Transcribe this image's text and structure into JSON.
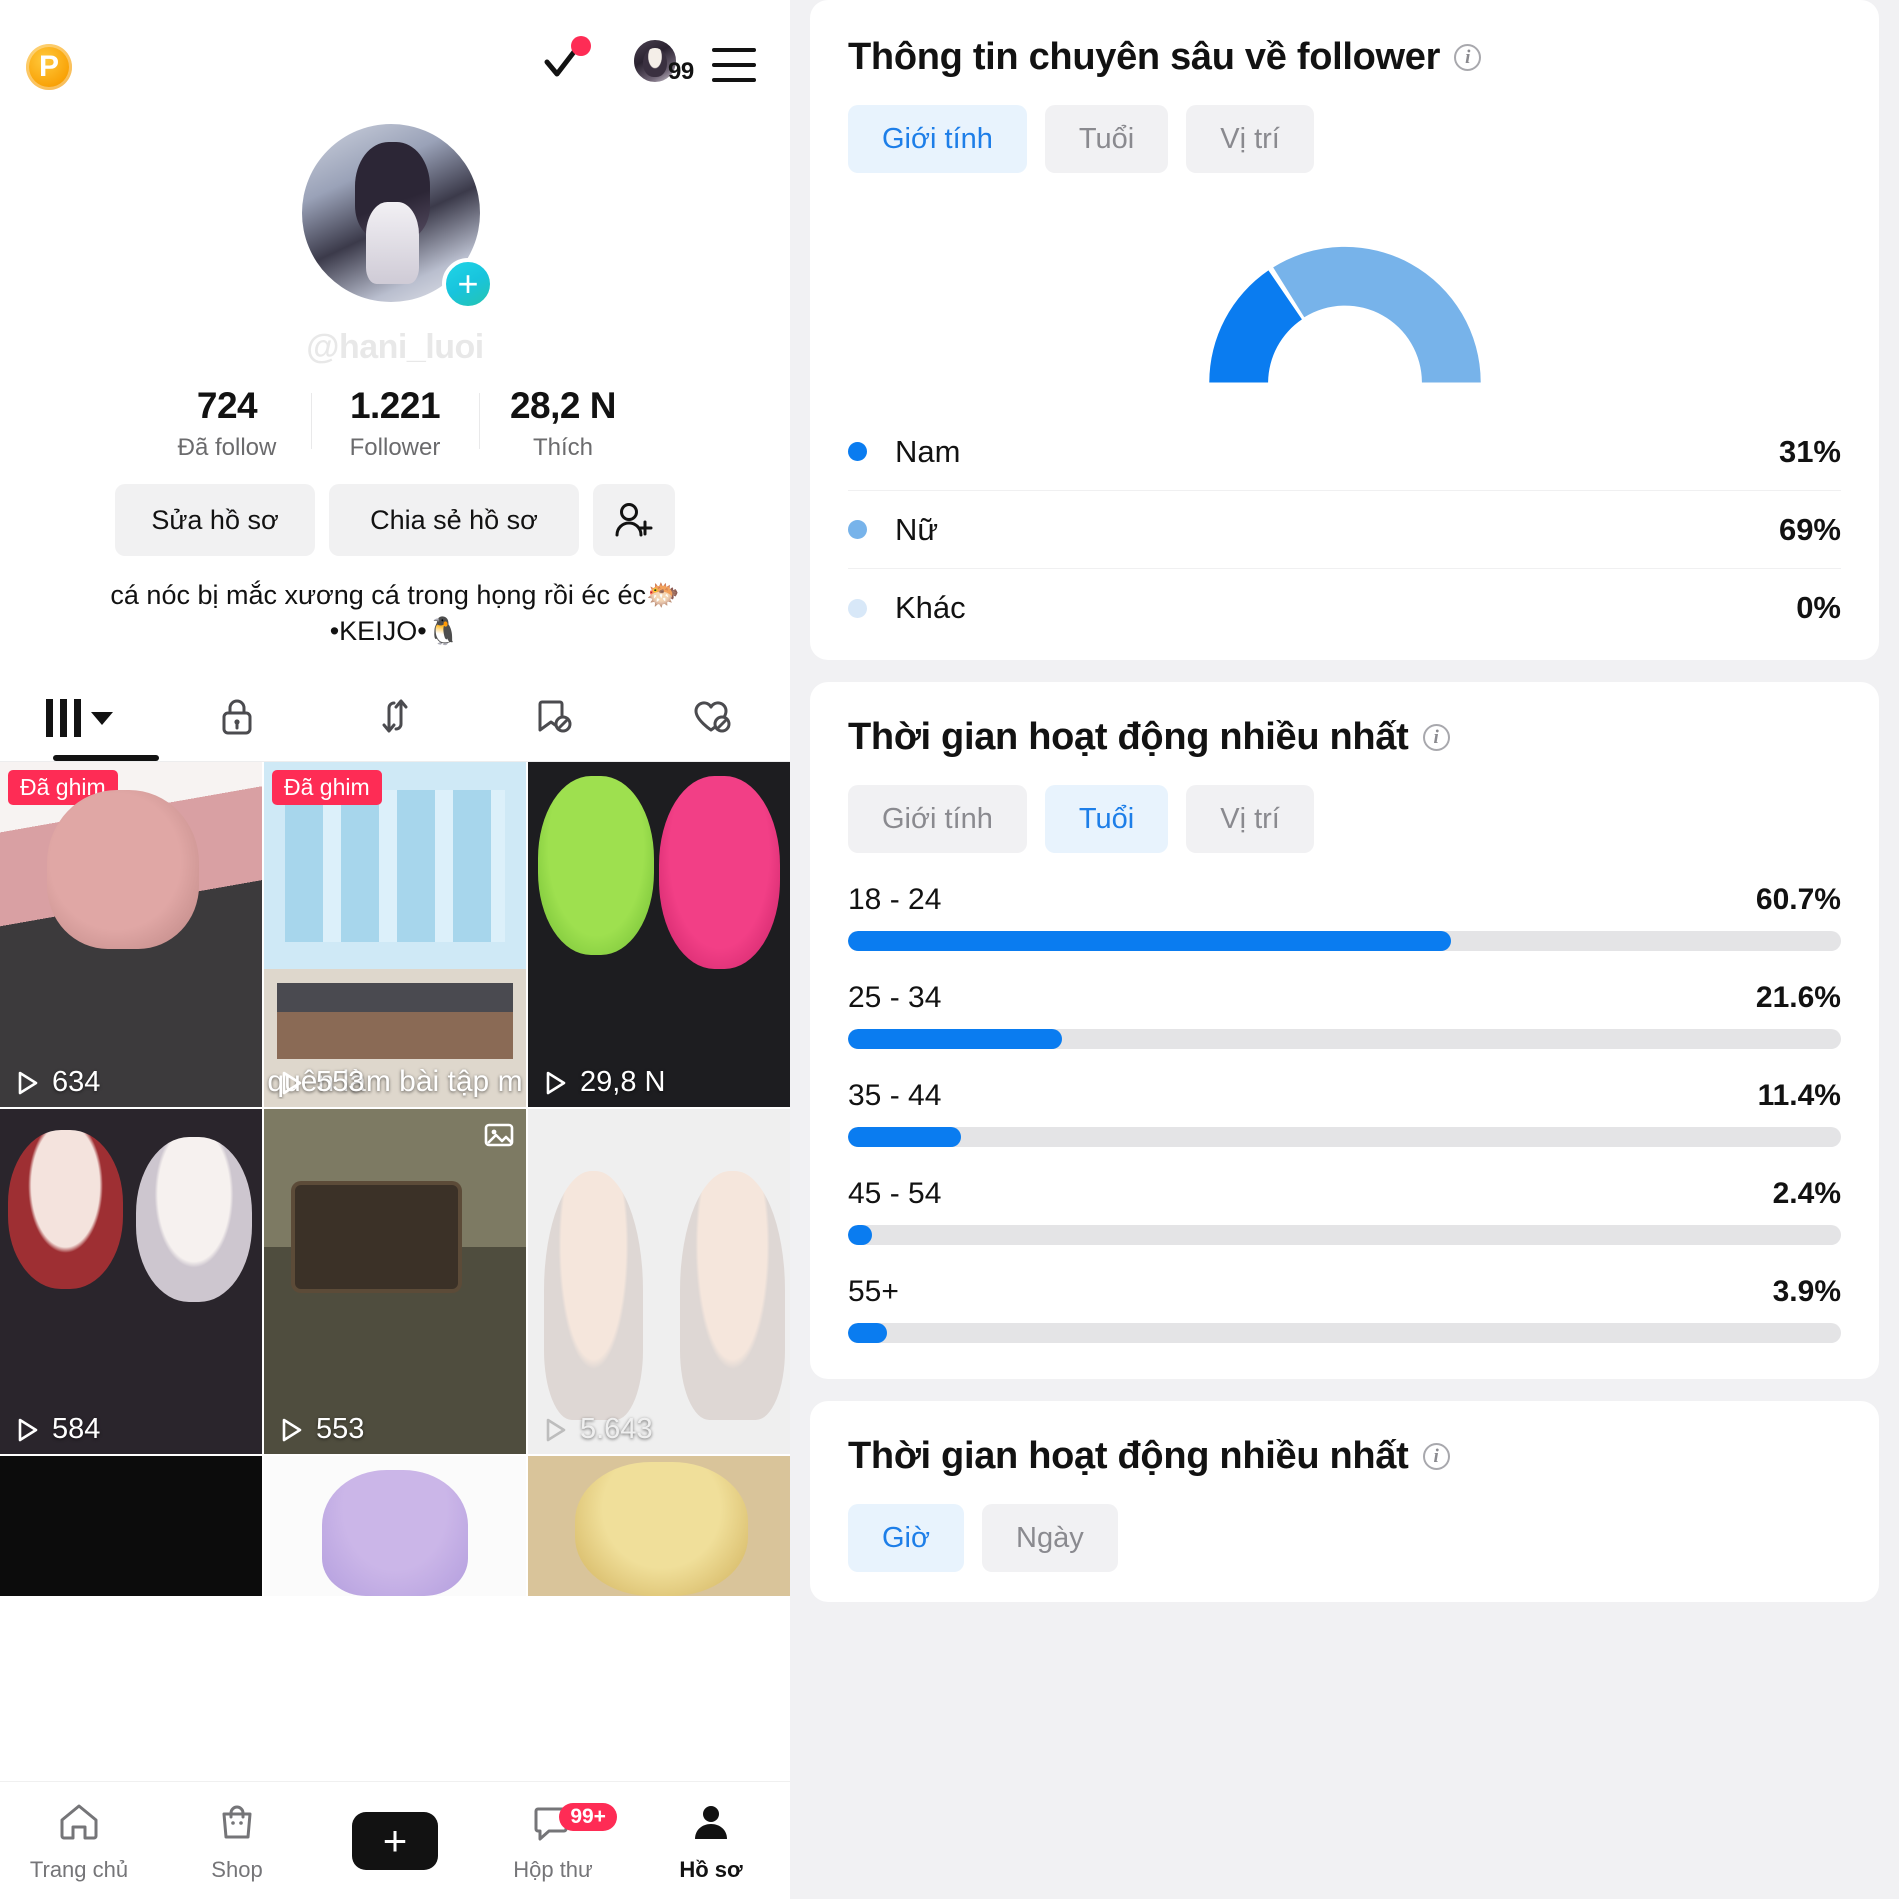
{
  "profile": {
    "topbar": {
      "coin_label": "P",
      "check_icon": "check-icon",
      "notification_dot": "notification-dot",
      "avatar_count": "99",
      "menu_icon": "hamburger-menu-icon"
    },
    "handle": "@hani_luoi",
    "avatar_add_label": "+",
    "stats": [
      {
        "num": "724",
        "label": "Đã follow"
      },
      {
        "num": "1.221",
        "label": "Follower"
      },
      {
        "num": "28,2 N",
        "label": "Thích"
      }
    ],
    "actions": {
      "edit": "Sửa hồ sơ",
      "share": "Chia sẻ hồ sơ",
      "add_friend_icon": "add-person-icon"
    },
    "bio": [
      "cá nóc bị mắc xương cá trong họng rồi éc éc🐡",
      "•KEIJO•🐧"
    ],
    "tabs": [
      {
        "icon": "grid-posts-icon",
        "active": true
      },
      {
        "icon": "lock-private-icon",
        "active": false
      },
      {
        "icon": "repost-icon",
        "active": false
      },
      {
        "icon": "saved-hidden-icon",
        "active": false
      },
      {
        "icon": "liked-hidden-icon",
        "active": false
      }
    ],
    "posts": [
      {
        "pin": "Đã ghim",
        "views": "634",
        "thumb": "t1",
        "multi": false
      },
      {
        "pin": "Đã ghim",
        "views": "553",
        "thumb": "t2",
        "multi": false,
        "caption": "quên làm bài tập m"
      },
      {
        "pin": "",
        "views": "29,8 N",
        "thumb": "t3",
        "multi": false
      },
      {
        "pin": "",
        "views": "584",
        "thumb": "t4",
        "multi": false
      },
      {
        "pin": "",
        "views": "553",
        "thumb": "t5",
        "multi": true
      },
      {
        "pin": "",
        "views": "5.643",
        "thumb": "t6",
        "multi": false
      },
      {
        "pin": "",
        "views": "",
        "thumb": "t7",
        "multi": false
      },
      {
        "pin": "",
        "views": "",
        "thumb": "t8",
        "multi": false
      },
      {
        "pin": "",
        "views": "",
        "thumb": "t9",
        "multi": false
      }
    ],
    "bottom_nav": [
      {
        "label": "Trang chủ",
        "icon": "home-icon",
        "badge": "",
        "active": false
      },
      {
        "label": "Shop",
        "icon": "shop-bag-icon",
        "badge": "",
        "active": false
      },
      {
        "label": "",
        "icon": "create-plus-icon",
        "badge": "",
        "active": false
      },
      {
        "label": "Hộp thư",
        "icon": "inbox-icon",
        "badge": "99+",
        "active": false
      },
      {
        "label": "Hồ sơ",
        "icon": "profile-person-icon",
        "badge": "",
        "active": true
      }
    ]
  },
  "analytics": {
    "gender_card": {
      "title": "Thông tin chuyên sâu về follower",
      "info_icon": "info-icon",
      "tabs": [
        {
          "label": "Giới tính",
          "active": true
        },
        {
          "label": "Tuổi",
          "active": false
        },
        {
          "label": "Vị trí",
          "active": false
        }
      ]
    },
    "age_card": {
      "title": "Thời gian hoạt động nhiều nhất",
      "info_icon": "info-icon",
      "tabs": [
        {
          "label": "Giới tính",
          "active": false
        },
        {
          "label": "Tuổi",
          "active": true
        },
        {
          "label": "Vị trí",
          "active": false
        }
      ]
    },
    "time_card": {
      "title": "Thời gian hoạt động nhiều nhất",
      "info_icon": "info-icon",
      "tabs": [
        {
          "label": "Giờ",
          "active": true
        },
        {
          "label": "Ngày",
          "active": false
        }
      ]
    },
    "colors": {
      "male": "#0a7cf0",
      "female": "#77b3ea",
      "other": "#d8e8f8",
      "bar_fill": "#0a7cf0",
      "bar_track": "#e4e4e6",
      "chip_active_bg": "#e8f3fd",
      "chip_active_text": "#1d7ee8",
      "brand_pink": "#fe2c55"
    }
  },
  "chart_data": [
    {
      "type": "pie",
      "title": "Thông tin chuyên sâu về follower",
      "subtitle": "Giới tính",
      "legend_position": "below",
      "labels": [
        "Nam",
        "Nữ",
        "Khác"
      ],
      "values": [
        31,
        69,
        0
      ],
      "value_labels": [
        "31%",
        "69%",
        "0%"
      ],
      "colors": [
        "#0a7cf0",
        "#77b3ea",
        "#d8e8f8"
      ]
    },
    {
      "type": "bar",
      "title": "Thời gian hoạt động nhiều nhất",
      "subtitle": "Tuổi",
      "orientation": "horizontal",
      "categories": [
        "18 - 24",
        "25 - 34",
        "35 - 44",
        "45 - 54",
        "55+"
      ],
      "values": [
        60.7,
        21.6,
        11.4,
        2.4,
        3.9
      ],
      "value_labels": [
        "60.7%",
        "21.6%",
        "11.4%",
        "2.4%",
        "3.9%"
      ],
      "xlabel": "",
      "ylabel": "",
      "xlim": [
        0,
        100
      ],
      "grid": false,
      "color": "#0a7cf0"
    }
  ]
}
